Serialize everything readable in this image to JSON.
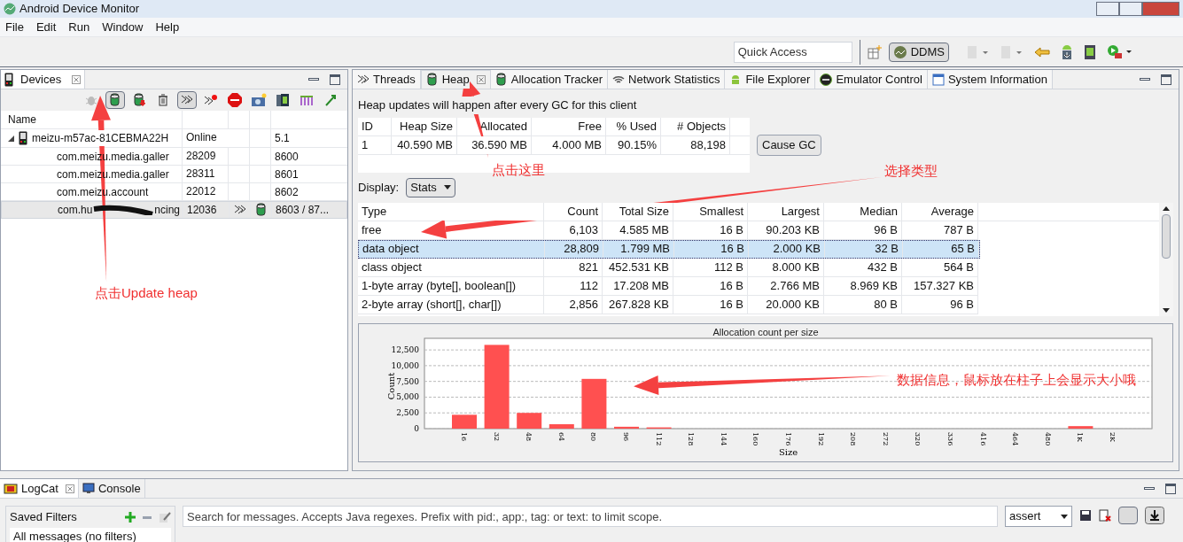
{
  "window": {
    "title": "Android Device Monitor"
  },
  "menu": [
    "File",
    "Edit",
    "Run",
    "Window",
    "Help"
  ],
  "toolbar": {
    "quick_access": {
      "placeholder": "Quick Access"
    },
    "perspective": {
      "label": "DDMS",
      "selected": true
    }
  },
  "devices_panel": {
    "title": "Devices",
    "columns": [
      "Name"
    ],
    "toolbar": [
      {
        "kind": "bug",
        "selected": false
      },
      {
        "kind": "heap",
        "selected": true
      },
      {
        "kind": "dump",
        "selected": false
      },
      {
        "kind": "gc",
        "selected": false
      },
      {
        "kind": "threads",
        "selected": true
      },
      {
        "kind": "method",
        "selected": false
      },
      {
        "kind": "stop",
        "selected": false
      },
      {
        "kind": "camera",
        "selected": false
      },
      {
        "kind": "screens",
        "selected": false
      },
      {
        "kind": "systrace",
        "selected": false
      },
      {
        "kind": "trace",
        "selected": false
      }
    ],
    "device": {
      "name": "meizu-m57ac-81CEBMA22H",
      "status": "Online",
      "version": "5.1",
      "expanded": true,
      "clients": [
        {
          "name": "com.meizu.media.galler",
          "pid": "28209",
          "port": "8600",
          "threads": false,
          "heap": false,
          "selected": false
        },
        {
          "name": "com.meizu.media.galler",
          "pid": "28311",
          "port": "8601",
          "threads": false,
          "heap": false,
          "selected": false
        },
        {
          "name": "com.meizu.account",
          "pid": "22012",
          "port": "8602",
          "threads": false,
          "heap": false,
          "selected": false
        },
        {
          "name": "com.hu",
          "name_tail": "ncing",
          "redacted": true,
          "pid": "12036",
          "port": "8603 / 87...",
          "threads": true,
          "heap": true,
          "selected": true
        }
      ]
    }
  },
  "tabs": [
    {
      "label": "Threads",
      "kind": "threads",
      "selected": false
    },
    {
      "label": "Heap",
      "kind": "heap",
      "selected": true
    },
    {
      "label": "Allocation Tracker",
      "kind": "heap",
      "selected": false
    },
    {
      "label": "Network Statistics",
      "kind": "wifi",
      "selected": false
    },
    {
      "label": "File Explorer",
      "kind": "android",
      "selected": false
    },
    {
      "label": "Emulator Control",
      "kind": "emulator",
      "selected": false
    },
    {
      "label": "System Information",
      "kind": "window",
      "selected": false
    }
  ],
  "heap": {
    "notice": "Heap updates will happen after every GC for this client",
    "columns": [
      "ID",
      "Heap Size",
      "Allocated",
      "Free",
      "% Used",
      "# Objects"
    ],
    "rows": [
      [
        "1",
        "40.590 MB",
        "36.590 MB",
        "4.000 MB",
        "90.15%",
        "88,198"
      ]
    ],
    "cause_gc": "Cause GC",
    "display_label": "Display:",
    "display_value": "Stats"
  },
  "stats": {
    "columns": [
      "Type",
      "Count",
      "Total Size",
      "Smallest",
      "Largest",
      "Median",
      "Average"
    ],
    "rows": [
      {
        "cells": [
          "free",
          "6,103",
          "4.585 MB",
          "16 B",
          "90.203 KB",
          "96 B",
          "787 B"
        ],
        "selected": false
      },
      {
        "cells": [
          "data object",
          "28,809",
          "1.799 MB",
          "16 B",
          "2.000 KB",
          "32 B",
          "65 B"
        ],
        "selected": true
      },
      {
        "cells": [
          "class object",
          "821",
          "452.531 KB",
          "112 B",
          "8.000 KB",
          "432 B",
          "564 B"
        ],
        "selected": false
      },
      {
        "cells": [
          "1-byte array (byte[], boolean[])",
          "112",
          "17.208 MB",
          "16 B",
          "2.766 MB",
          "8.969 KB",
          "157.327 KB"
        ],
        "selected": false
      },
      {
        "cells": [
          "2-byte array (short[], char[])",
          "2,856",
          "267.828 KB",
          "16 B",
          "20.000 KB",
          "80 B",
          "96 B"
        ],
        "selected": false
      }
    ]
  },
  "chart": {
    "chart_data": {
      "type": "bar",
      "title": "Allocation count per size",
      "xlabel": "Size",
      "ylabel": "Count",
      "categories": [
        "16",
        "32",
        "48",
        "64",
        "80",
        "96",
        "112",
        "128",
        "144",
        "160",
        "176",
        "192",
        "208",
        "272",
        "320",
        "336",
        "416",
        "464",
        "480",
        "1K",
        "2K"
      ],
      "series": [
        {
          "color": "#ff5050",
          "values": [
            2200,
            13300,
            2500,
            700,
            7900,
            300,
            200,
            0,
            0,
            0,
            0,
            0,
            0,
            0,
            0,
            0,
            0,
            0,
            0,
            400,
            0
          ]
        }
      ],
      "grid": true,
      "ylim": [
        0,
        13500
      ],
      "yticks": [
        {
          "value": 0,
          "label": "0"
        },
        {
          "value": 2500,
          "label": "2,500"
        },
        {
          "value": 5000,
          "label": "5,000"
        },
        {
          "value": 7500,
          "label": "7,500"
        },
        {
          "value": 10000,
          "label": "10,000"
        },
        {
          "value": 12500,
          "label": "12,500"
        }
      ]
    }
  },
  "bottom": {
    "tabs": [
      {
        "label": "LogCat",
        "selected": true
      },
      {
        "label": "Console",
        "selected": false
      }
    ],
    "saved_filters": "Saved Filters",
    "filters": [
      {
        "label": "All messages (no filters)",
        "selected": true
      }
    ],
    "search": {
      "placeholder": "Search for messages. Accepts Java regexes. Prefix with pid:, app:, tag: or text: to limit scope."
    },
    "level": "assert"
  },
  "annotations": [
    {
      "text": "点击Update heap"
    },
    {
      "text": "点击这里"
    },
    {
      "text": "选择类型"
    },
    {
      "text": "数据信息，鼠标放在柱子上会显示大小哦"
    }
  ]
}
